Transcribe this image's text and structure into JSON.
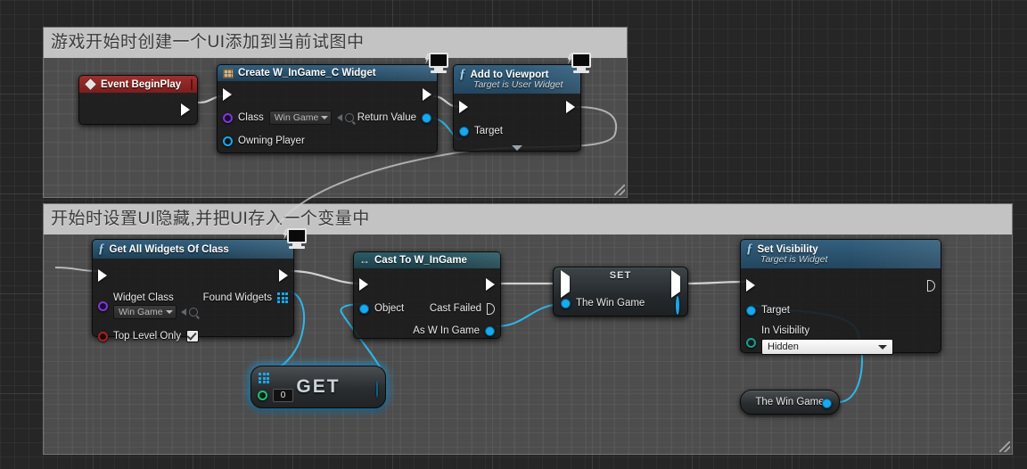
{
  "canvas": {
    "background_color": "#262626",
    "grid_color": "#333333"
  },
  "comments": [
    {
      "id": "comment-create-ui",
      "title": "游戏开始时创建一个UI添加到当前试图中",
      "color": "#c3c3c3"
    },
    {
      "id": "comment-hide-ui",
      "title": "开始时设置UI隐藏,并把UI存入一个变量中",
      "color": "#c3c3c3"
    }
  ],
  "nodes": {
    "event_begin_play": {
      "title": "Event BeginPlay",
      "icon": "event-diamond-icon",
      "header_color": "#9e2f2f",
      "exec_out": ""
    },
    "create_widget": {
      "title": "Create W_InGame_C Widget",
      "icon": "widget-icon",
      "header_color": "#33607f",
      "pins": {
        "class_label": "Class",
        "class_value": "Win Game",
        "owning_player_label": "Owning Player",
        "return_value_label": "Return Value"
      }
    },
    "add_to_viewport": {
      "title": "Add to Viewport",
      "subtitle": "Target is User Widget",
      "icon": "function-icon",
      "header_color": "#33607f",
      "pins": {
        "target_label": "Target"
      }
    },
    "get_all_widgets": {
      "title": "Get All Widgets Of Class",
      "icon": "function-icon",
      "header_color": "#33607f",
      "pins": {
        "widget_class_label": "Widget Class",
        "widget_class_value": "Win Game",
        "top_level_only_label": "Top Level Only",
        "top_level_only_checked": true,
        "found_widgets_label": "Found Widgets"
      }
    },
    "get_array_item": {
      "title": "GET",
      "index_value": "0"
    },
    "cast_to_w_ingame": {
      "title": "Cast To W_InGame",
      "icon": "cast-arrow-icon",
      "header_color": "#2c5c66",
      "pins": {
        "object_label": "Object",
        "cast_failed_label": "Cast Failed",
        "as_win_game_label": "As W In Game"
      }
    },
    "set_variable": {
      "title": "SET",
      "pins": {
        "the_win_game_label": "The Win Game"
      }
    },
    "set_visibility": {
      "title": "Set Visibility",
      "subtitle": "Target is Widget",
      "icon": "function-icon",
      "header_color": "#33607f",
      "pins": {
        "target_label": "Target",
        "in_visibility_label": "In Visibility",
        "in_visibility_value": "Hidden"
      }
    },
    "the_win_game_getter": {
      "title": "The Win Game"
    }
  },
  "wire_colors": {
    "exec": "#d8d8d8",
    "object": "#2fb6ea",
    "array": "#2fb6ea"
  }
}
